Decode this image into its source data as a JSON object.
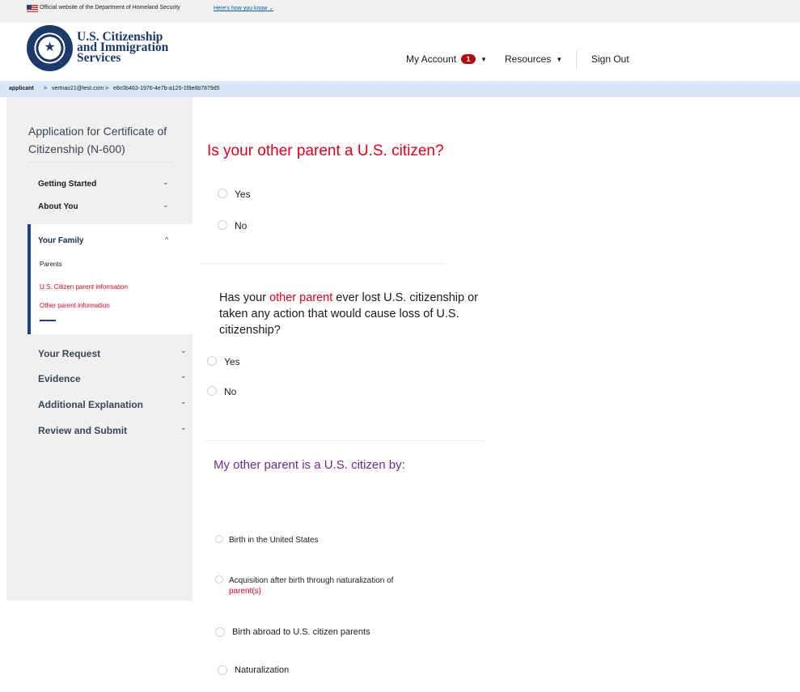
{
  "banner": {
    "official_text": "Official website of the Department of Homeland Security",
    "how_link": "Here's how you know",
    "how_caret": "⌄"
  },
  "header": {
    "agency_line1": "U.S. Citizenship",
    "agency_line2": "and Immigration",
    "agency_line3": "Services",
    "my_account": "My Account",
    "notification_count": "1",
    "caret": "▼",
    "resources": "Resources",
    "sign_out": "Sign Out"
  },
  "breadcrumb": {
    "root": "applicant",
    "sep": ">",
    "email": "vertnav21@test.com",
    "case_id": "e8c0b463-1976-4e7b-a125-1f8e6b7879d5"
  },
  "sidebar": {
    "app_title": "Application for Certificate of Citizenship (N-600)",
    "chevron_down": "⌄",
    "chevron_up": "^",
    "sections_top": [
      "Getting Started",
      "About You"
    ],
    "family": {
      "title": "Your Family",
      "items": [
        "Parents",
        "U.S. Citizen parent information",
        "Other parent information"
      ]
    },
    "sections_bottom": [
      "Your Request",
      "Evidence",
      "Additional Explanation",
      "Review and Submit"
    ]
  },
  "main": {
    "q1": {
      "question": "Is your other parent a U.S. citizen?",
      "options": [
        "Yes",
        "No"
      ]
    },
    "q2": {
      "question_pre": "Has your ",
      "question_highlight": "other parent",
      "question_post": " ever lost U.S. citizenship or taken any action that would cause loss of U.S. citizenship?",
      "options": [
        "Yes",
        "No"
      ]
    },
    "q3": {
      "question": "My other parent is a U.S. citizen by:",
      "options": [
        "Birth in the United States",
        "Acquisition after birth through naturalization of",
        "Birth abroad to U.S. citizen parents",
        "Naturalization"
      ],
      "option2_highlight": "parent(s)"
    }
  },
  "colors": {
    "accent_red": "#e0001b",
    "nav_blue": "#1a4480",
    "purple": "#6b2c91",
    "breadcrumb_bg": "#d9e8f6"
  }
}
